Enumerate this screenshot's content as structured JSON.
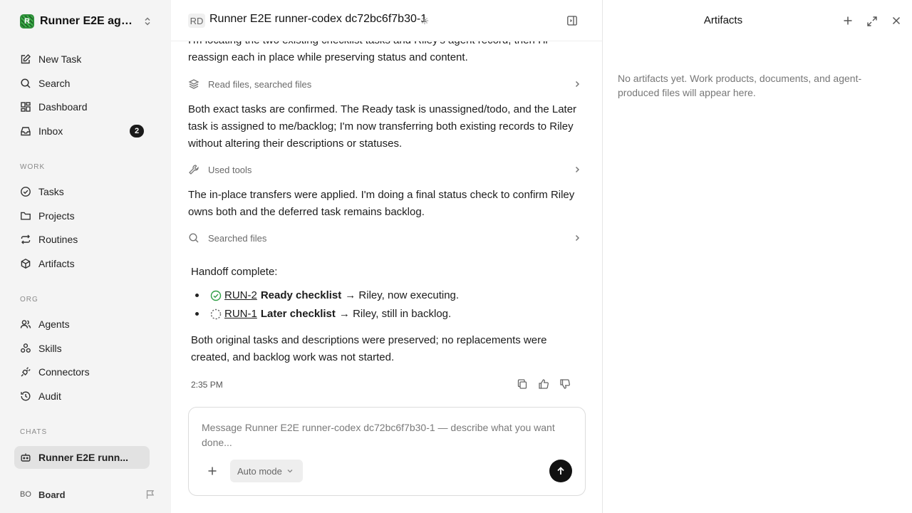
{
  "workspace": {
    "name": "Runner E2E agen...",
    "logo_letter": "R"
  },
  "nav": {
    "new_task": "New Task",
    "search": "Search",
    "dashboard": "Dashboard",
    "inbox": "Inbox",
    "inbox_count": "2"
  },
  "sections": {
    "work": "WORK",
    "org": "ORG",
    "chats": "CHATS"
  },
  "work_items": {
    "tasks": "Tasks",
    "projects": "Projects",
    "routines": "Routines",
    "artifacts": "Artifacts"
  },
  "org_items": {
    "agents": "Agents",
    "skills": "Skills",
    "connectors": "Connectors",
    "audit": "Audit"
  },
  "chats": {
    "active": "Runner E2E runn..."
  },
  "user": {
    "initials": "BO",
    "name": "Board"
  },
  "header": {
    "initials": "RD",
    "title": "Runner E2E runner-codex dc72bc6f7b30-1"
  },
  "conversation": {
    "msg1": "I'm locating the two existing checklist tasks and Riley's agent record, then I'll reassign each in place while preserving status and content.",
    "tool1": "Read files, searched files",
    "msg2": "Both exact tasks are confirmed. The Ready task is unassigned/todo, and the Later task is assigned to me/backlog; I'm now transferring both existing records to Riley without altering their descriptions or statuses.",
    "tool2": "Used tools",
    "msg3": "The in-place transfers were applied. I'm doing a final status check to confirm Riley owns both and the deferred task remains backlog.",
    "tool3": "Searched files",
    "final_heading": "Handoff complete:",
    "bullets": [
      {
        "code": "RUN-2",
        "name": "Ready checklist",
        "rest": "→ Riley, now executing."
      },
      {
        "code": "RUN-1",
        "name": "Later checklist",
        "rest": "→ Riley, still in backlog."
      }
    ],
    "final_note": "Both original tasks and descriptions were preserved; no replacements were created, and backlog work was not started.",
    "timestamp": "2:35 PM"
  },
  "composer": {
    "placeholder": "Message Runner E2E runner-codex dc72bc6f7b30-1 — describe what you want done...",
    "mode": "Auto mode"
  },
  "artifacts_panel": {
    "title": "Artifacts",
    "empty": "No artifacts yet. Work products, documents, and agent-produced files will appear here."
  }
}
